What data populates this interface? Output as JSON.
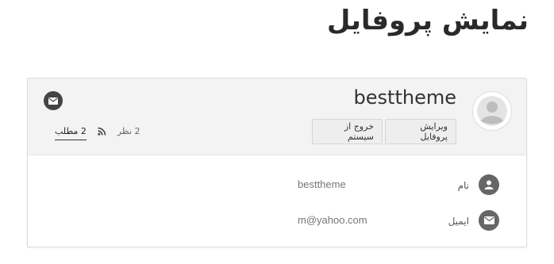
{
  "page": {
    "title": "نمایش پروفایل"
  },
  "profile": {
    "username": "besttheme",
    "edit_button": "ویرایش پروفایل",
    "logout_button": "خروج از سیستم",
    "stats": {
      "posts": "2 مطلب",
      "comments": "2 نظر"
    },
    "fields": {
      "name_label": "نام",
      "name_value": "besttheme",
      "email_label": "ایمیل",
      "email_value": "m@yahoo.com"
    }
  },
  "icons": {
    "avatar": "user-avatar-icon",
    "mail": "envelope-icon",
    "rss": "rss-icon",
    "user": "user-icon"
  },
  "colors": {
    "header_bg": "#f3f3f3",
    "icon_circle": "#666666",
    "button_bg": "#eeeeee"
  }
}
